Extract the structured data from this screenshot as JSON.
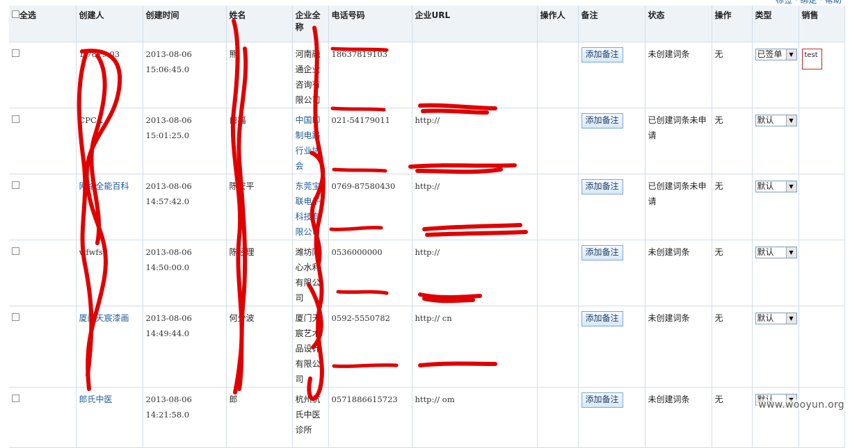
{
  "header": {
    "top_link": "标签 · 绑定 · 帮助",
    "columns": {
      "select_all": "全选",
      "creator": "创建人",
      "created_time": "创建时间",
      "name": "姓名",
      "company_full_name": "企业全称",
      "phone": "电话号码",
      "company_url": "企业URL",
      "operator": "操作人",
      "remark": "备注",
      "status": "状态",
      "action": "操作",
      "type": "类型",
      "sales": "销售"
    }
  },
  "rows": [
    {
      "creator": "1 7819 03",
      "created_time": "2013-08-06 15:06:45.0",
      "name": "熊",
      "company": "河南融通企业咨询有限公司",
      "phone": "18637819103",
      "url": "",
      "remark_btn": "添加备注",
      "status": "未创建词条",
      "action": "无",
      "type": "已签单",
      "sales": "test"
    },
    {
      "creator": "CPCA",
      "created_time": "2013-08-06 15:01:25.0",
      "name": "白福",
      "company": "中国印制电路行业协会",
      "phone": "021-54179011",
      "url": "http://",
      "remark_btn": "添加备注",
      "status": "已创建词条未申请",
      "action": "无",
      "type": "默认",
      "sales": ""
    },
    {
      "creator": "网络全能百科",
      "created_time": "2013-08-06 14:57:42.0",
      "name": "陈安平",
      "company": "东莞宝联电子科技有限公司",
      "phone": "0769-87580430",
      "url": "http://",
      "remark_btn": "添加备注",
      "status": "已创建词条未申请",
      "action": "无",
      "type": "默认",
      "sales": ""
    },
    {
      "creator": "wfwfs",
      "created_time": "2013-08-06 14:50:00.0",
      "name": "陈经理",
      "company": "潍坊同心水利有限公司",
      "phone": "0536000000",
      "url": "http://",
      "remark_btn": "添加备注",
      "status": "未创建词条",
      "action": "无",
      "type": "默认",
      "sales": ""
    },
    {
      "creator": "厦门天宸漆画",
      "created_time": "2013-08-06 14:49:44.0",
      "name": "何少波",
      "company": "厦门天宸艺术品设计有限公司",
      "phone": "0592-5550782",
      "url": "http://                 cn",
      "remark_btn": "添加备注",
      "status": "未创建词条",
      "action": "无",
      "type": "默认",
      "sales": ""
    },
    {
      "creator": "郎氏中医",
      "created_time": "2013-08-06 14:21:58.0",
      "name": "郎",
      "company": "杭州杭氏中医诊所",
      "phone": "0571886615723",
      "url": "http://                 om",
      "remark_btn": "添加备注",
      "status": "未创建词条",
      "action": "无",
      "type": "默认",
      "sales": ""
    }
  ],
  "watermark": "www.wooyun.org",
  "colors": {
    "header_bg": "#eef3f8",
    "border": "#d2dde8",
    "link": "#1e5b9a",
    "redaction": "#e00000"
  }
}
